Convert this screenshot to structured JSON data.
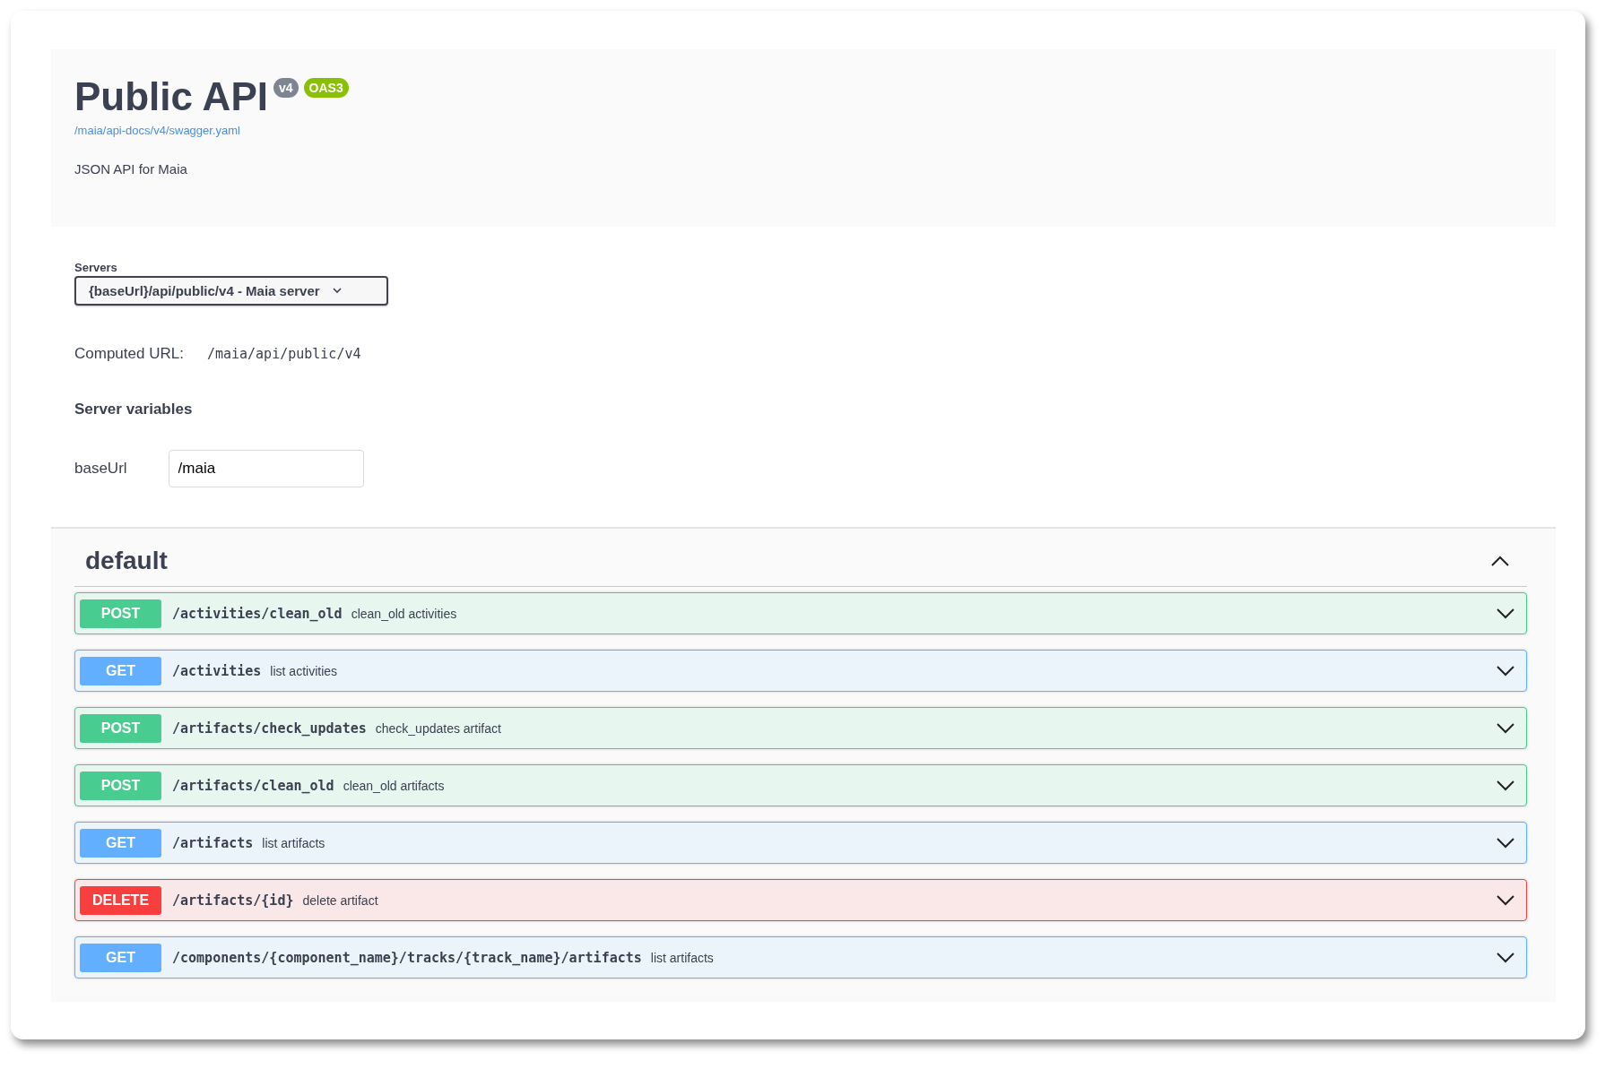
{
  "info": {
    "title": "Public API",
    "badges": [
      {
        "label": "v4",
        "kind": "version"
      },
      {
        "label": "OAS3",
        "kind": "spec"
      }
    ],
    "spec_link": "/maia/api-docs/v4/swagger.yaml",
    "description": "JSON API for Maia"
  },
  "servers": {
    "label": "Servers",
    "selected_server": "{baseUrl}/api/public/v4 - Maia server",
    "computed_url_label": "Computed URL:",
    "computed_url": "/maia/api/public/v4",
    "variables_title": "Server variables",
    "variables": [
      {
        "name": "baseUrl",
        "value": "/maia"
      }
    ]
  },
  "section": {
    "title": "default",
    "expanded": true,
    "operations": [
      {
        "kind": "post",
        "method": "POST",
        "path": "/activities/clean_old",
        "summary": "clean_old activities"
      },
      {
        "kind": "get",
        "method": "GET",
        "path": "/activities",
        "summary": "list activities"
      },
      {
        "kind": "post",
        "method": "POST",
        "path": "/artifacts/check_updates",
        "summary": "check_updates artifact"
      },
      {
        "kind": "post",
        "method": "POST",
        "path": "/artifacts/clean_old",
        "summary": "clean_old artifacts"
      },
      {
        "kind": "get",
        "method": "GET",
        "path": "/artifacts",
        "summary": "list artifacts"
      },
      {
        "kind": "delete",
        "method": "DELETE",
        "path": "/artifacts/{id}",
        "summary": "delete artifact"
      },
      {
        "kind": "get",
        "method": "GET",
        "path": "/components/{component_name}/tracks/{track_name}/artifacts",
        "summary": "list artifacts"
      }
    ]
  }
}
